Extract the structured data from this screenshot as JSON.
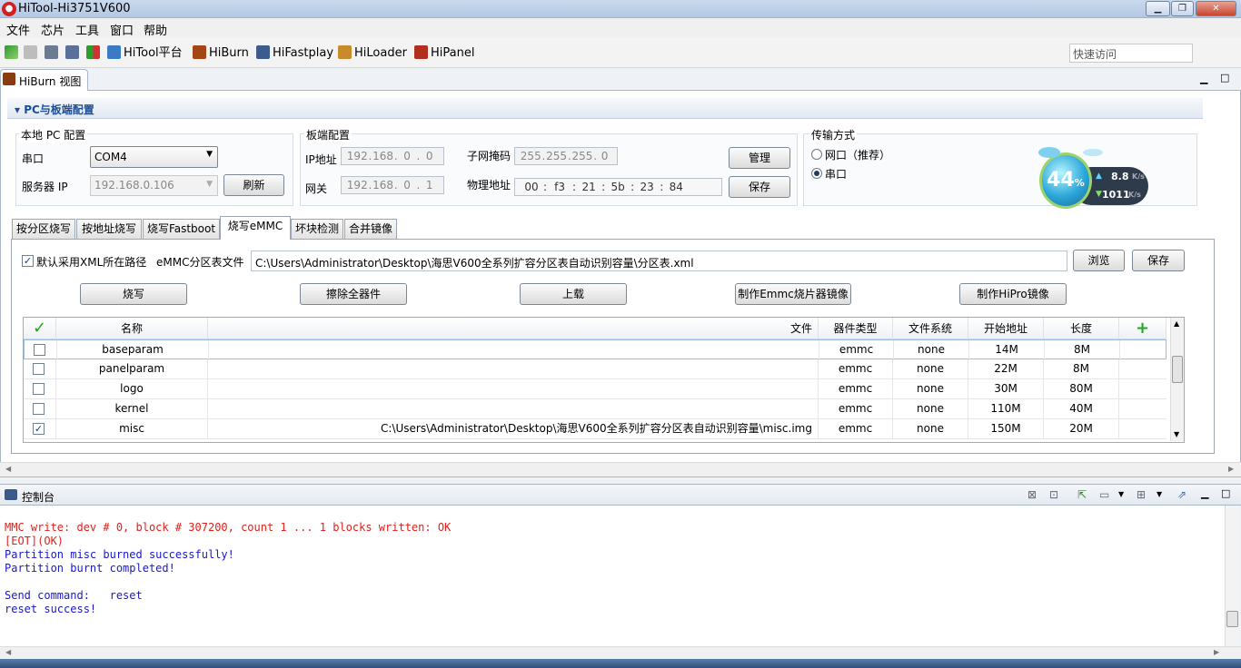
{
  "window": {
    "title": "HiTool-Hi3751V600"
  },
  "menu": [
    "文件",
    "芯片",
    "工具",
    "窗口",
    "帮助"
  ],
  "toolbar": {
    "items": [
      {
        "label": "HiTool平台",
        "icon": "home-icon"
      },
      {
        "label": "HiBurn",
        "icon": "hiburn-icon"
      },
      {
        "label": "HiFastplay",
        "icon": "hifastplay-icon"
      },
      {
        "label": "HiLoader",
        "icon": "hiloader-icon"
      },
      {
        "label": "HiPanel",
        "icon": "hipanel-icon"
      }
    ],
    "quick_access_placeholder": "快速访问"
  },
  "view": {
    "tab_label": "HiBurn 视图",
    "section_title": "PC与板端配置"
  },
  "local_pc": {
    "group_label": "本地 PC 配置",
    "serial_label": "串口",
    "serial_value": "COM4",
    "server_ip_label": "服务器 IP",
    "server_ip_value": "192.168.0.106",
    "refresh_button": "刷新"
  },
  "board": {
    "group_label": "板端配置",
    "ip_label": "IP地址",
    "ip": [
      "192",
      "168",
      "0",
      "0"
    ],
    "gateway_label": "网关",
    "gateway": [
      "192",
      "168",
      "0",
      "1"
    ],
    "mask_label": "子网掩码",
    "mask": [
      "255",
      "255",
      "255",
      "0"
    ],
    "mac_label": "物理地址",
    "mac": [
      "00",
      "f3",
      "21",
      "5b",
      "23",
      "84"
    ],
    "manage_button": "管理",
    "save_button": "保存"
  },
  "transfer": {
    "group_label": "传输方式",
    "options": [
      {
        "label": "网口（推荐）",
        "selected": false
      },
      {
        "label": "串口",
        "selected": true
      }
    ]
  },
  "net_widget": {
    "percent": "44",
    "percent_sign": "%",
    "up": "8.8",
    "down": "1011",
    "unit": "K/s"
  },
  "tabs": [
    {
      "label": "按分区烧写",
      "selected": false
    },
    {
      "label": "按地址烧写",
      "selected": false
    },
    {
      "label": "烧写Fastboot",
      "selected": false
    },
    {
      "label": "烧写eMMC",
      "selected": true
    },
    {
      "label": "坏块检测",
      "selected": false
    },
    {
      "label": "合并镜像",
      "selected": false
    }
  ],
  "emmc": {
    "use_xml_path_label": "默认采用XML所在路径",
    "use_xml_path_checked": true,
    "partition_file_label": "eMMC分区表文件",
    "partition_file_value": "C:\\Users\\Administrator\\Desktop\\海思V600全系列扩容分区表自动识别容量\\分区表.xml",
    "browse_button": "浏览",
    "save_button": "保存",
    "actions": [
      "烧写",
      "擦除全器件",
      "上载",
      "制作Emmc烧片器镜像",
      "制作HiPro镜像"
    ]
  },
  "table": {
    "columns": [
      "名称",
      "文件",
      "器件类型",
      "文件系统",
      "开始地址",
      "长度"
    ],
    "rows": [
      {
        "checked": false,
        "name": "baseparam",
        "file": "",
        "device": "emmc",
        "fs": "none",
        "start": "14M",
        "length": "8M"
      },
      {
        "checked": false,
        "name": "panelparam",
        "file": "",
        "device": "emmc",
        "fs": "none",
        "start": "22M",
        "length": "8M"
      },
      {
        "checked": false,
        "name": "logo",
        "file": "",
        "device": "emmc",
        "fs": "none",
        "start": "30M",
        "length": "80M"
      },
      {
        "checked": false,
        "name": "kernel",
        "file": "",
        "device": "emmc",
        "fs": "none",
        "start": "110M",
        "length": "40M"
      },
      {
        "checked": true,
        "name": "misc",
        "file": "C:\\Users\\Administrator\\Desktop\\海思V600全系列扩容分区表自动识别容量\\misc.img",
        "device": "emmc",
        "fs": "none",
        "start": "150M",
        "length": "20M"
      }
    ]
  },
  "console": {
    "tab_label": "控制台",
    "lines": [
      {
        "text": "MMC write: dev # 0, block # 307200, count 1 ... 1 blocks written: OK",
        "color": "#e0201b"
      },
      {
        "text": "[EOT](OK)",
        "color": "#e0201b"
      },
      {
        "text": "Partition misc burned successfully!",
        "color": "#1919c8"
      },
      {
        "text": "Partition burnt completed!",
        "color": "#1919c8"
      },
      {
        "text": "",
        "color": "#1919c8"
      },
      {
        "text": "Send command:   reset",
        "color": "#1919c8"
      },
      {
        "text": "reset success!",
        "color": "#1919c8"
      }
    ]
  },
  "colors": {
    "error_red": "#e0201b",
    "info_blue": "#1919c8",
    "section_blue": "#1d4f96",
    "add_green": "#27a327"
  }
}
